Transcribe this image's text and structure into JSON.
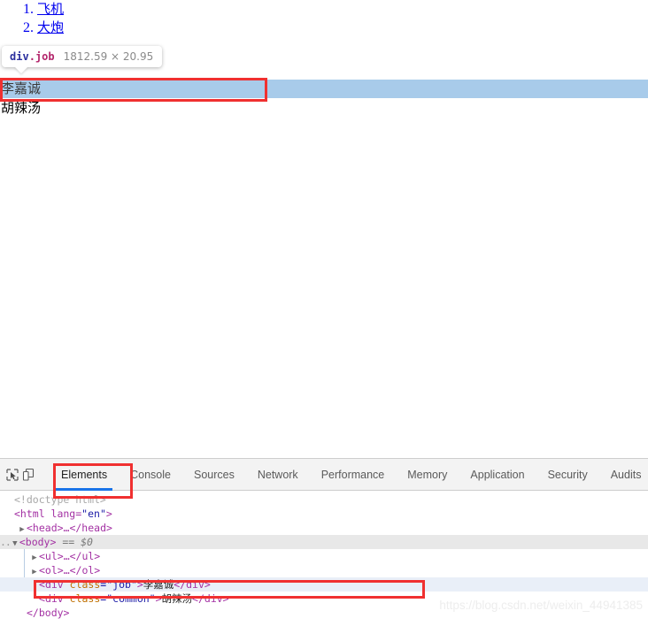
{
  "page": {
    "ordered_list": [
      {
        "num": "1.",
        "label": "飞机"
      },
      {
        "num": "2.",
        "label": "大炮"
      }
    ],
    "job_text": "李嘉诚",
    "common_text": "胡辣汤"
  },
  "inspect_tooltip": {
    "tag": "div",
    "class": ".job",
    "dimensions": "1812.59 × 20.95"
  },
  "devtools": {
    "icons": {
      "inspect": "inspect-element-icon",
      "device": "device-toolbar-icon"
    },
    "tabs": [
      {
        "label": "Elements",
        "active": true
      },
      {
        "label": "Console",
        "active": false
      },
      {
        "label": "Sources",
        "active": false
      },
      {
        "label": "Network",
        "active": false
      },
      {
        "label": "Performance",
        "active": false
      },
      {
        "label": "Memory",
        "active": false
      },
      {
        "label": "Application",
        "active": false
      },
      {
        "label": "Security",
        "active": false
      },
      {
        "label": "Audits",
        "active": false
      }
    ],
    "dom": {
      "doctype": "<!doctype html>",
      "html_open_a": "<html lang=",
      "html_lang_value": "\"en\"",
      "html_open_b": ">",
      "head_collapsed": "<head>…</head>",
      "body_open": "<body>",
      "body_marker": "== $0",
      "ul_collapsed": "<ul>…</ul>",
      "ol_collapsed": "<ol>…</ol>",
      "job_div": {
        "open_lt": "<",
        "tag": "div",
        "attr_name": "class",
        "attr_eq": "=",
        "attr_value": "\"job\"",
        "gt": ">",
        "text": "李嘉诚",
        "close": "</div>"
      },
      "common_div": {
        "open_lt": "<",
        "tag": "div",
        "attr_name": "class",
        "attr_eq": "=",
        "attr_value": "\"common\"",
        "gt": ">",
        "text": "胡辣汤",
        "close": "</div>"
      },
      "body_close": "</body>"
    }
  },
  "watermark": {
    "text": "https://blog.csdn.net/weixin_44941385"
  },
  "colors": {
    "selection_highlight": "#a8cbea",
    "annotation_red": "#f03030",
    "tab_active_underline": "#1a73e8",
    "link_blue": "#0000ee",
    "tooltip_tag": "#2b2f9e",
    "tooltip_class": "#b3256b"
  }
}
